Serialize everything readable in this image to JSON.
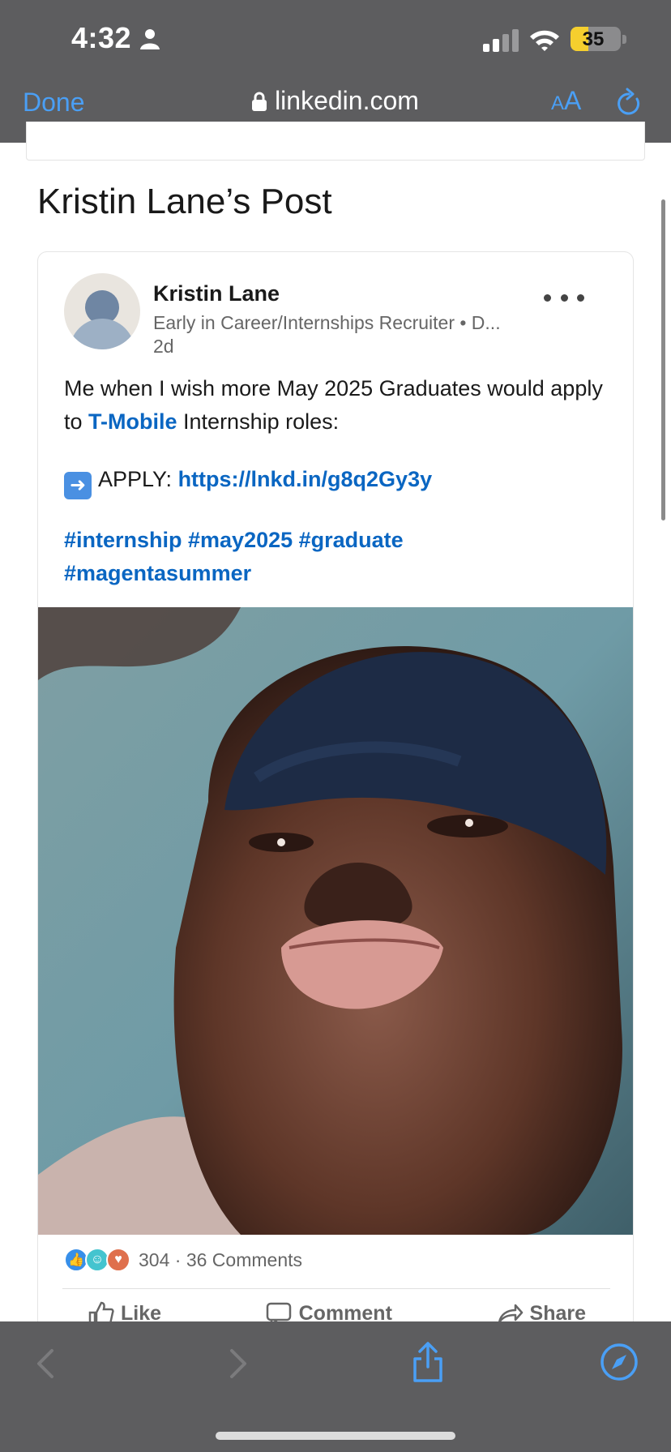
{
  "status_bar": {
    "time": "4:32",
    "battery": "35",
    "battery_level": 0.35,
    "colors": {
      "battery": "#f5cf2e"
    }
  },
  "browser": {
    "done_label": "Done",
    "url": "linkedin.com",
    "text_size_label_small": "A",
    "text_size_label_large": "A",
    "accent_color": "#4a9ff5"
  },
  "page": {
    "title": "Kristin Lane’s Post"
  },
  "post": {
    "author_name": "Kristin Lane",
    "author_headline": "Early in Career/Internships Recruiter • D...",
    "timestamp": "2d",
    "text_line1_a": "Me when I wish more May 2025 Graduates would apply to ",
    "mention": "T-Mobile",
    "text_line1_b": " Internship roles:",
    "apply_label": "APPLY: ",
    "apply_link": "https://lnkd.in/g8q2Gy3y",
    "hashtags_line1": "#internship #may2025 #graduate",
    "hashtags_line2": "#magentasummer",
    "reaction_count": "304",
    "comments": "36 Comments",
    "actions": {
      "like": "Like",
      "comment": "Comment",
      "share": "Share"
    },
    "link_color": "#0a66c2"
  },
  "icons": [
    "person-icon",
    "signal-icon",
    "wifi-icon",
    "battery-icon",
    "lock-icon",
    "reload-icon",
    "more-icon",
    "like-reaction-icon",
    "funny-reaction-icon",
    "love-reaction-icon",
    "like-icon",
    "comment-icon",
    "share-icon",
    "back-icon",
    "forward-icon",
    "share-sheet-icon",
    "compass-icon",
    "arrow-right-emoji"
  ]
}
